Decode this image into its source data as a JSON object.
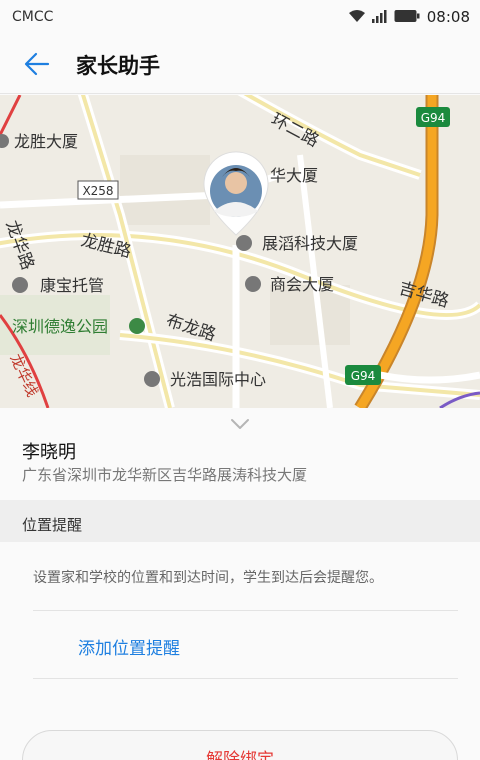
{
  "status_bar": {
    "carrier": "CMCC",
    "time": "08:08",
    "icons": [
      "wifi-icon",
      "signal-icon",
      "battery-icon"
    ]
  },
  "app_bar": {
    "back_icon": "arrow-left-icon",
    "title": "家长助手"
  },
  "map": {
    "labels": {
      "ring_road": "环二路",
      "longsheng_building": "龙胜大厦",
      "x258": "X258",
      "hua_building": "华大厦",
      "zhantao_building": "展滔科技大厦",
      "longsheng_road": "龙胜路",
      "longhua_road": "龙华路",
      "kangbao_nursery": "康宝托管",
      "shanghui_building": "商会大厦",
      "jihua_road": "吉华路",
      "deyi_park": "深圳德逸公园",
      "bulong_road": "布龙路",
      "guanghao_center": "光浩国际中心",
      "longhua_line": "龙华线",
      "g94": "G94"
    },
    "colors": {
      "background": "#efece4",
      "road": "#ffffff",
      "highway": "#f5a623",
      "label": "#333333"
    }
  },
  "person": {
    "name": "李晓明",
    "address": "广东省深圳市龙华新区吉华路展涛科技大厦"
  },
  "reminders": {
    "section_title": "位置提醒",
    "description": "设置家和学校的位置和到达时间，学生到达后会提醒您。",
    "add_label": "添加位置提醒"
  },
  "actions": {
    "unbind_label": "解除绑定"
  },
  "colors": {
    "accent": "#1e7fe0",
    "danger": "#e53935"
  }
}
